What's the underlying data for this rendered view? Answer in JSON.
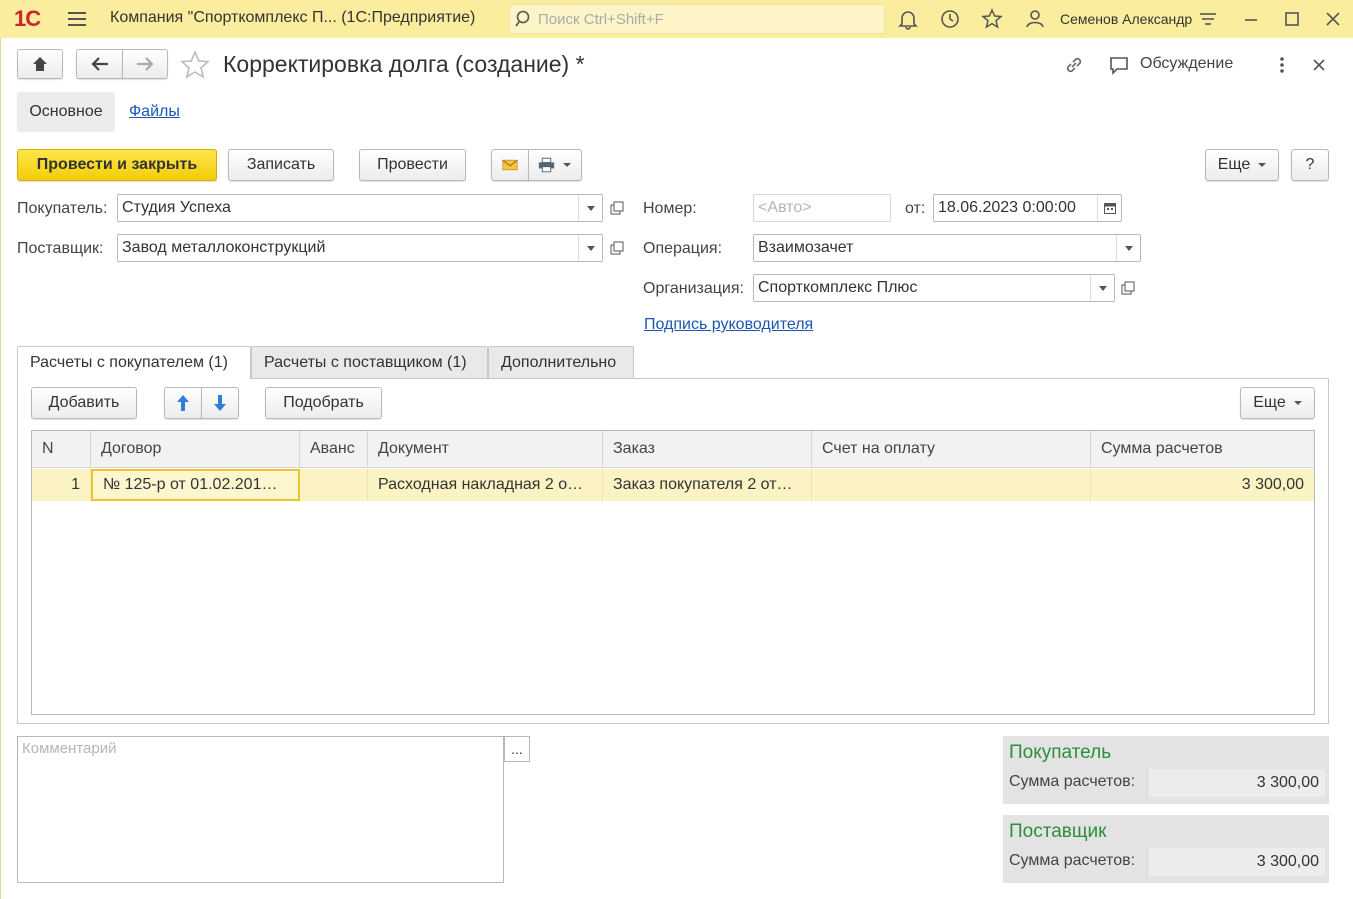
{
  "titlebar": {
    "logo": "1С",
    "app_title": "Компания \"Спорткомплекс П...  (1С:Предприятие)",
    "search_placeholder": "Поиск Ctrl+Shift+F",
    "user_name": "Семенов Александр"
  },
  "header": {
    "title": "Корректировка долга (создание) *",
    "discussion_label": "Обсуждение"
  },
  "sections": {
    "main": "Основное",
    "files": "Файлы"
  },
  "toolbar": {
    "post_close": "Провести и закрыть",
    "save": "Записать",
    "post": "Провести",
    "more": "Еще",
    "help": "?"
  },
  "form": {
    "buyer_label": "Покупатель:",
    "buyer_value": "Студия Успеха",
    "supplier_label": "Поставщик:",
    "supplier_value": "Завод металлоконструкций",
    "number_label": "Номер:",
    "number_placeholder": "<Авто>",
    "date_label": "от:",
    "date_value": "18.06.2023  0:00:00",
    "operation_label": "Операция:",
    "operation_value": "Взаимозачет",
    "org_label": "Организация:",
    "org_value": "Спорткомплекс Плюс",
    "signature_link": "Подпись руководителя"
  },
  "tabs": [
    {
      "label": "Расчеты с покупателем (1)"
    },
    {
      "label": "Расчеты с поставщиком (1)"
    },
    {
      "label": "Дополнительно"
    }
  ],
  "table_toolbar": {
    "add": "Добавить",
    "pick": "Подобрать",
    "more": "Еще"
  },
  "table": {
    "columns": [
      "N",
      "Договор",
      "Аванс",
      "Документ",
      "Заказ",
      "Счет на оплату",
      "Сумма расчетов"
    ],
    "rows": [
      {
        "n": "1",
        "contract": "№ 125-р от 01.02.201…",
        "advance": "",
        "document": "Расходная накладная 2 о…",
        "order": "Заказ покупателя 2 от…",
        "invoice": "",
        "sum": "3 300,00"
      }
    ]
  },
  "comment": {
    "placeholder": "Комментарий",
    "button": "..."
  },
  "totals": {
    "buyer": {
      "title": "Покупатель",
      "label": "Сумма расчетов:",
      "value": "3 300,00"
    },
    "supplier": {
      "title": "Поставщик",
      "label": "Сумма расчетов:",
      "value": "3 300,00"
    }
  },
  "colors": {
    "accent_yellow": "#f5d214",
    "titlebar": "#fbed9e",
    "link": "#1b56b5",
    "total_title": "#2a8f3b"
  }
}
